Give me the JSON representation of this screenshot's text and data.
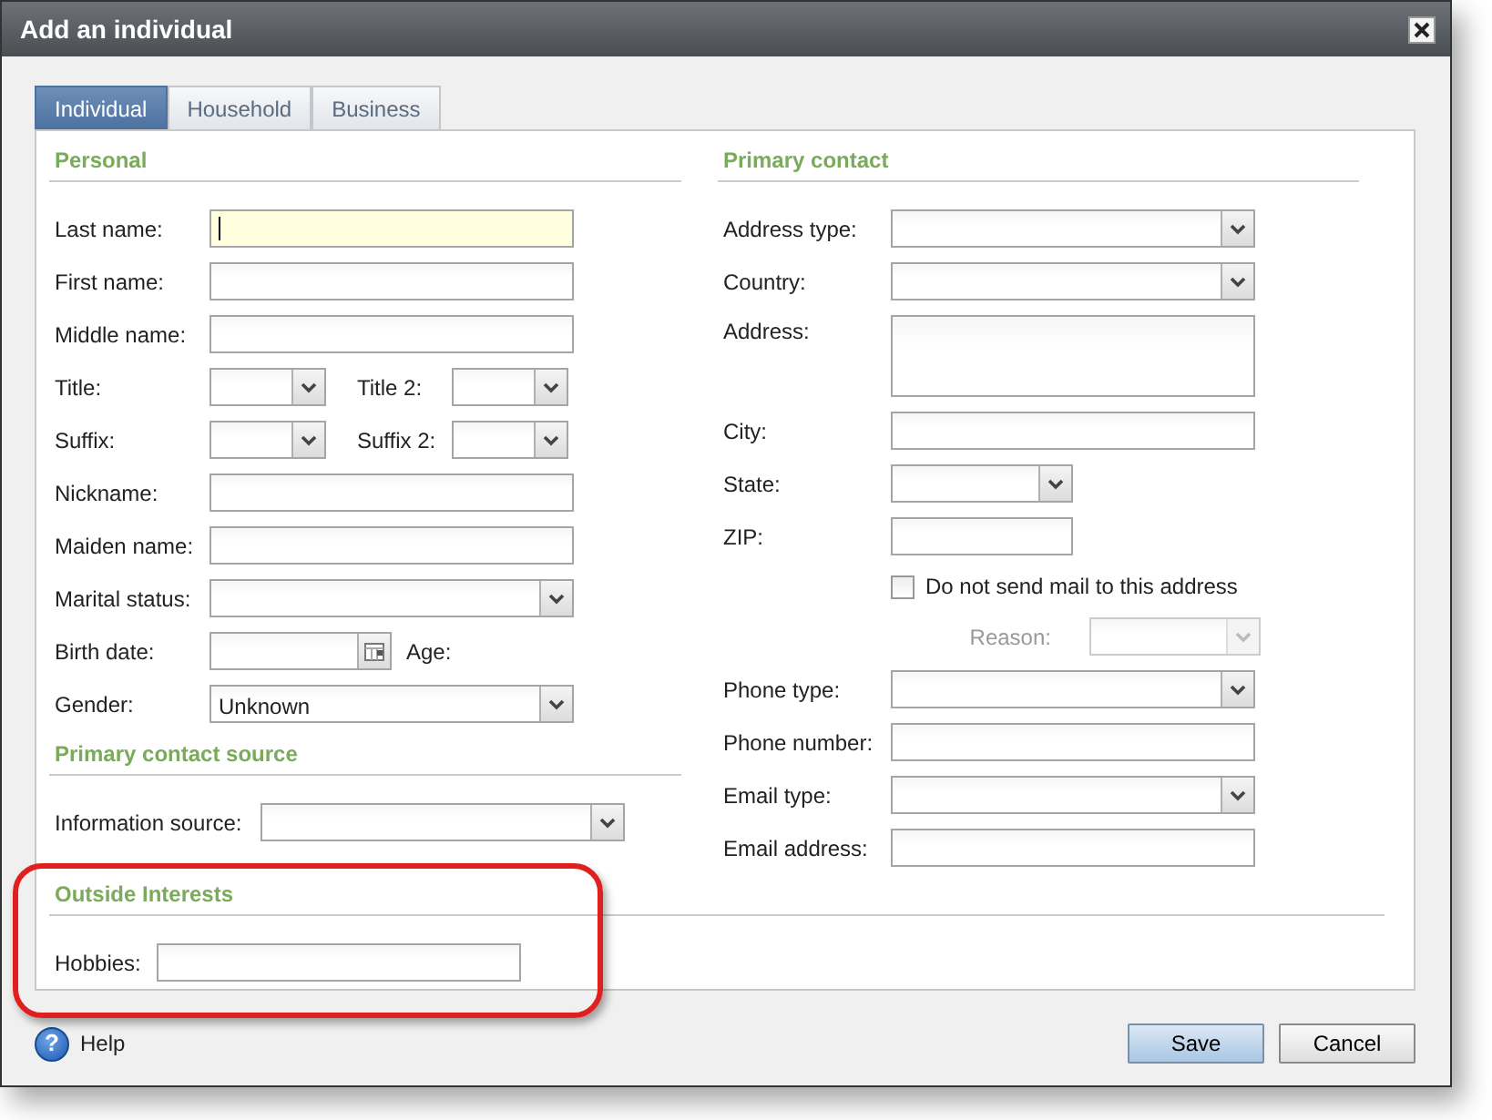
{
  "window": {
    "title": "Add an individual"
  },
  "tabs": [
    {
      "label": "Individual",
      "selected": true
    },
    {
      "label": "Household",
      "selected": false
    },
    {
      "label": "Business",
      "selected": false
    }
  ],
  "left_sections": [
    {
      "title": "Personal",
      "fields": [
        {
          "kind": "text",
          "label": "Last name:",
          "focused": true
        },
        {
          "kind": "text",
          "label": "First name:"
        },
        {
          "kind": "text",
          "label": "Middle name:"
        },
        {
          "kind": "pair",
          "items": [
            {
              "label": "Title:"
            },
            {
              "label": "Title 2:"
            }
          ]
        },
        {
          "kind": "pair",
          "items": [
            {
              "label": "Suffix:"
            },
            {
              "label": "Suffix 2:"
            }
          ]
        },
        {
          "kind": "text",
          "label": "Nickname:"
        },
        {
          "kind": "text",
          "label": "Maiden name:"
        },
        {
          "kind": "select",
          "label": "Marital status:"
        },
        {
          "kind": "date",
          "label": "Birth date:",
          "after": "Age:"
        },
        {
          "kind": "select",
          "label": "Gender:",
          "value": "Unknown"
        }
      ]
    },
    {
      "title": "Primary contact source",
      "fields": [
        {
          "kind": "select",
          "label": "Information source:"
        }
      ]
    }
  ],
  "right_sections": [
    {
      "title": "Primary contact",
      "fields": [
        {
          "kind": "select",
          "label": "Address type:"
        },
        {
          "kind": "select",
          "label": "Country:"
        },
        {
          "kind": "textarea",
          "label": "Address:"
        },
        {
          "kind": "text",
          "label": "City:"
        },
        {
          "kind": "small_select",
          "label": "State:"
        },
        {
          "kind": "small_text",
          "label": "ZIP:"
        },
        {
          "kind": "checkbox",
          "label": "Do not send mail to this address",
          "checked": false
        },
        {
          "kind": "select",
          "label": "Reason:",
          "disabled": true
        },
        {
          "kind": "select",
          "label": "Phone type:"
        },
        {
          "kind": "text",
          "label": "Phone number:"
        },
        {
          "kind": "select",
          "label": "Email type:"
        },
        {
          "kind": "text",
          "label": "Email address:"
        }
      ]
    }
  ],
  "bottom_section": {
    "title": "Outside Interests",
    "highlighted": true,
    "fields": [
      {
        "kind": "text",
        "label": "Hobbies:"
      }
    ]
  },
  "footer": {
    "help_glyph": "?",
    "help": "Help",
    "buttons": [
      {
        "label": "Save",
        "default": true
      },
      {
        "label": "Cancel",
        "default": false
      }
    ]
  }
}
